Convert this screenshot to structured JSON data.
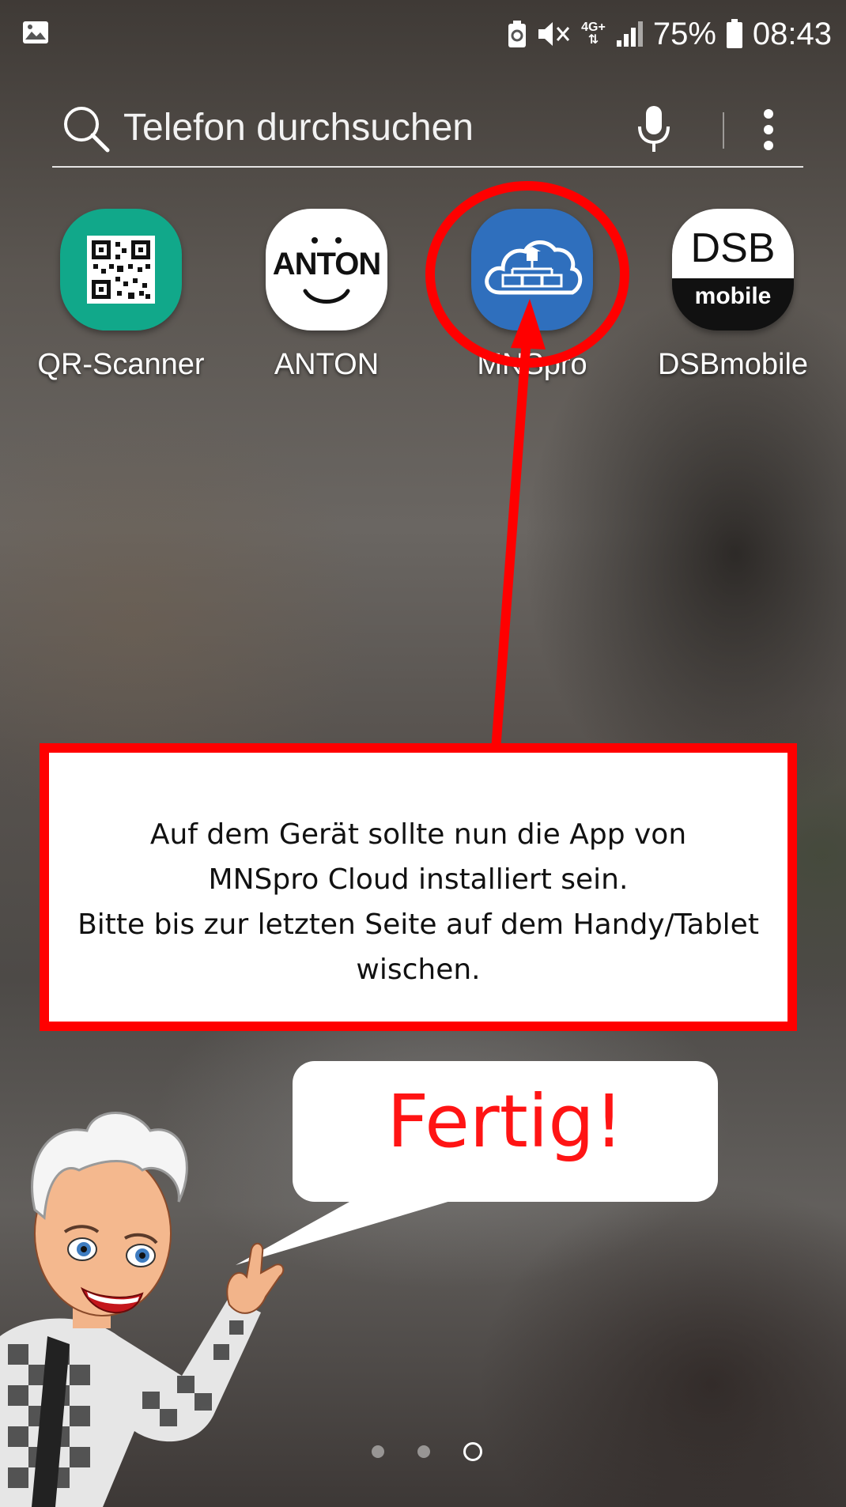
{
  "status_bar": {
    "battery_percent": "75%",
    "time": "08:43",
    "network": "4G+",
    "icons": [
      "gallery-icon",
      "battery-saver-icon",
      "mute-icon",
      "network-4g-icon",
      "signal-icon",
      "battery-icon"
    ]
  },
  "search": {
    "placeholder": "Telefon durchsuchen",
    "icons": [
      "search-icon",
      "mic-icon",
      "more-icon"
    ]
  },
  "apps": [
    {
      "label": "QR-Scanner",
      "icon": "qr-code-icon",
      "color": "#11a88a"
    },
    {
      "label": "ANTON",
      "icon": "anton-face-icon",
      "logo_text": "ANTON",
      "color": "#ffffff"
    },
    {
      "label": "MNSpro",
      "icon": "cloud-network-icon",
      "color": "#2f6fbd"
    },
    {
      "label": "DSBmobile",
      "icon": "dsb-logo-icon",
      "logo_text_top": "DSB",
      "logo_text_bottom": "mobile",
      "color": "#111111"
    }
  ],
  "annotation": {
    "lines": [
      "Auf dem Gerät sollte nun die App von",
      "MNSpro Cloud installiert sein.",
      "Bitte bis zur letzten Seite auf dem Handy/Tablet",
      "wischen."
    ],
    "highlight_color": "#ff0000"
  },
  "speech_bubble": {
    "text": "Fertig!",
    "text_color": "#ff1414"
  },
  "page_indicator": {
    "pages": 3,
    "current": 3
  }
}
